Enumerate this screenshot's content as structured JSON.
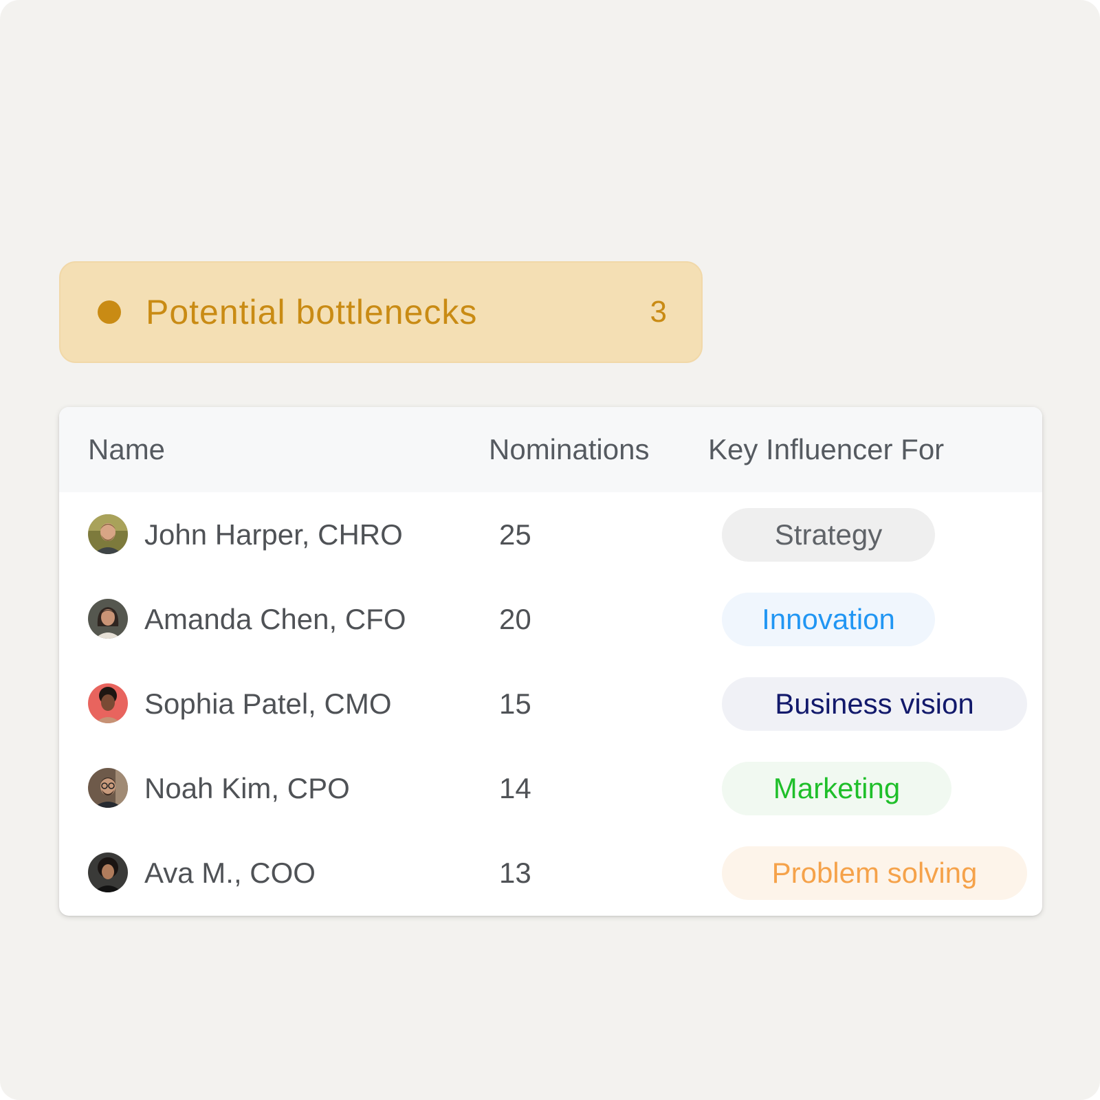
{
  "banner": {
    "title": "Potential bottlenecks",
    "count": "3",
    "color": "#c98b14",
    "background": "#f4dfb4"
  },
  "table": {
    "columns": [
      "Name",
      "Nominations",
      "Key Influencer For"
    ],
    "rows": [
      {
        "name": "John Harper, CHRO",
        "nominations": "25",
        "tag": "Strategy",
        "tag_color": "#5f6368",
        "tag_bg": "#efefef",
        "avatar_icon": "man-beard-avatar"
      },
      {
        "name": "Amanda Chen, CFO",
        "nominations": "20",
        "tag": "Innovation",
        "tag_color": "#2196f3",
        "tag_bg": "#f0f6fd",
        "avatar_icon": "woman-long-hair-avatar"
      },
      {
        "name": "Sophia Patel, CMO",
        "nominations": "15",
        "tag": "Business vision",
        "tag_color": "#12196b",
        "tag_bg": "#f0f1f6",
        "avatar_icon": "woman-curly-hair-avatar"
      },
      {
        "name": "Noah Kim, CPO",
        "nominations": "14",
        "tag": "Marketing",
        "tag_color": "#1fbf2a",
        "tag_bg": "#f1f9f1",
        "avatar_icon": "man-glasses-avatar"
      },
      {
        "name": "Ava M., COO",
        "nominations": "13",
        "tag": "Problem solving",
        "tag_color": "#f5a24a",
        "tag_bg": "#fdf4ea",
        "avatar_icon": "woman-curly-dark-avatar"
      }
    ]
  }
}
